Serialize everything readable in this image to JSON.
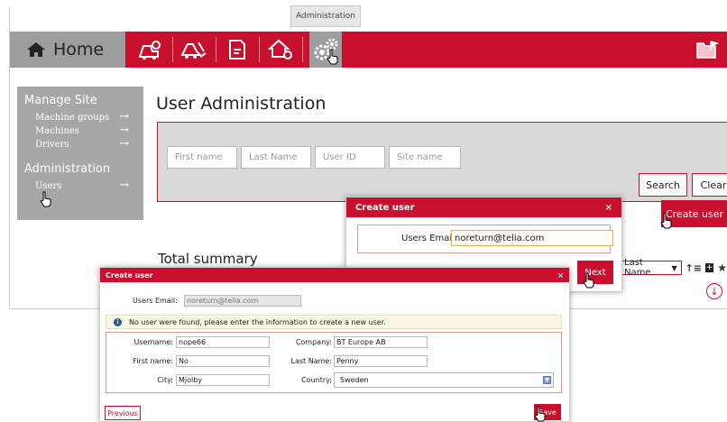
{
  "tooltip": {
    "text": "Administration"
  },
  "nav": {
    "home_label": "Home",
    "icons": [
      "machine-key-icon",
      "machine-wrench-icon",
      "report-icon",
      "home-gear-icon",
      "gears-icon",
      "flag-folder-icon"
    ]
  },
  "sidebar": {
    "manage_site": "Manage Site",
    "manage_items": [
      {
        "label": "Machine groups"
      },
      {
        "label": "Machines"
      },
      {
        "label": "Drivers"
      }
    ],
    "administration": "Administration",
    "admin_items": [
      {
        "label": "Users"
      }
    ]
  },
  "main": {
    "title": "User Administration",
    "filters": {
      "first_name": "First name",
      "last_name": "Last Name",
      "user_id": "User ID",
      "site_name": "Site name"
    },
    "search_label": "Search",
    "clear_label": "Clear",
    "create_user_label": "Create user",
    "summary_title": "Total summary",
    "sort_value": "Last Name"
  },
  "dialog1": {
    "title": "Create user",
    "close": "×",
    "email_label": "Users Email:",
    "email_value": "noreturn@telia.com",
    "next_label": "Next"
  },
  "dialog2": {
    "title": "Create user",
    "close": "×",
    "email_label": "Users Email:",
    "email_value": "noreturn@telia.com",
    "info_message": "No user were found, please enter the information to create a new user.",
    "username_label": "Username:",
    "username_value": "nope66",
    "firstname_label": "First name:",
    "firstname_value": "No",
    "city_label": "City:",
    "city_value": "Mjolby",
    "company_label": "Company:",
    "company_value": "BT Europe AB",
    "lastname_label": "Last Name:",
    "lastname_value": "Penny",
    "country_label": "Country:",
    "country_value": "Sweden",
    "previous_label": "Previous",
    "save_label": "Save"
  },
  "colors": {
    "brand_red": "#c8102e",
    "nav_gray": "#9d9d9d",
    "sidebar_gray": "#a7a7a7",
    "panel_gray": "#d9d9d9"
  }
}
